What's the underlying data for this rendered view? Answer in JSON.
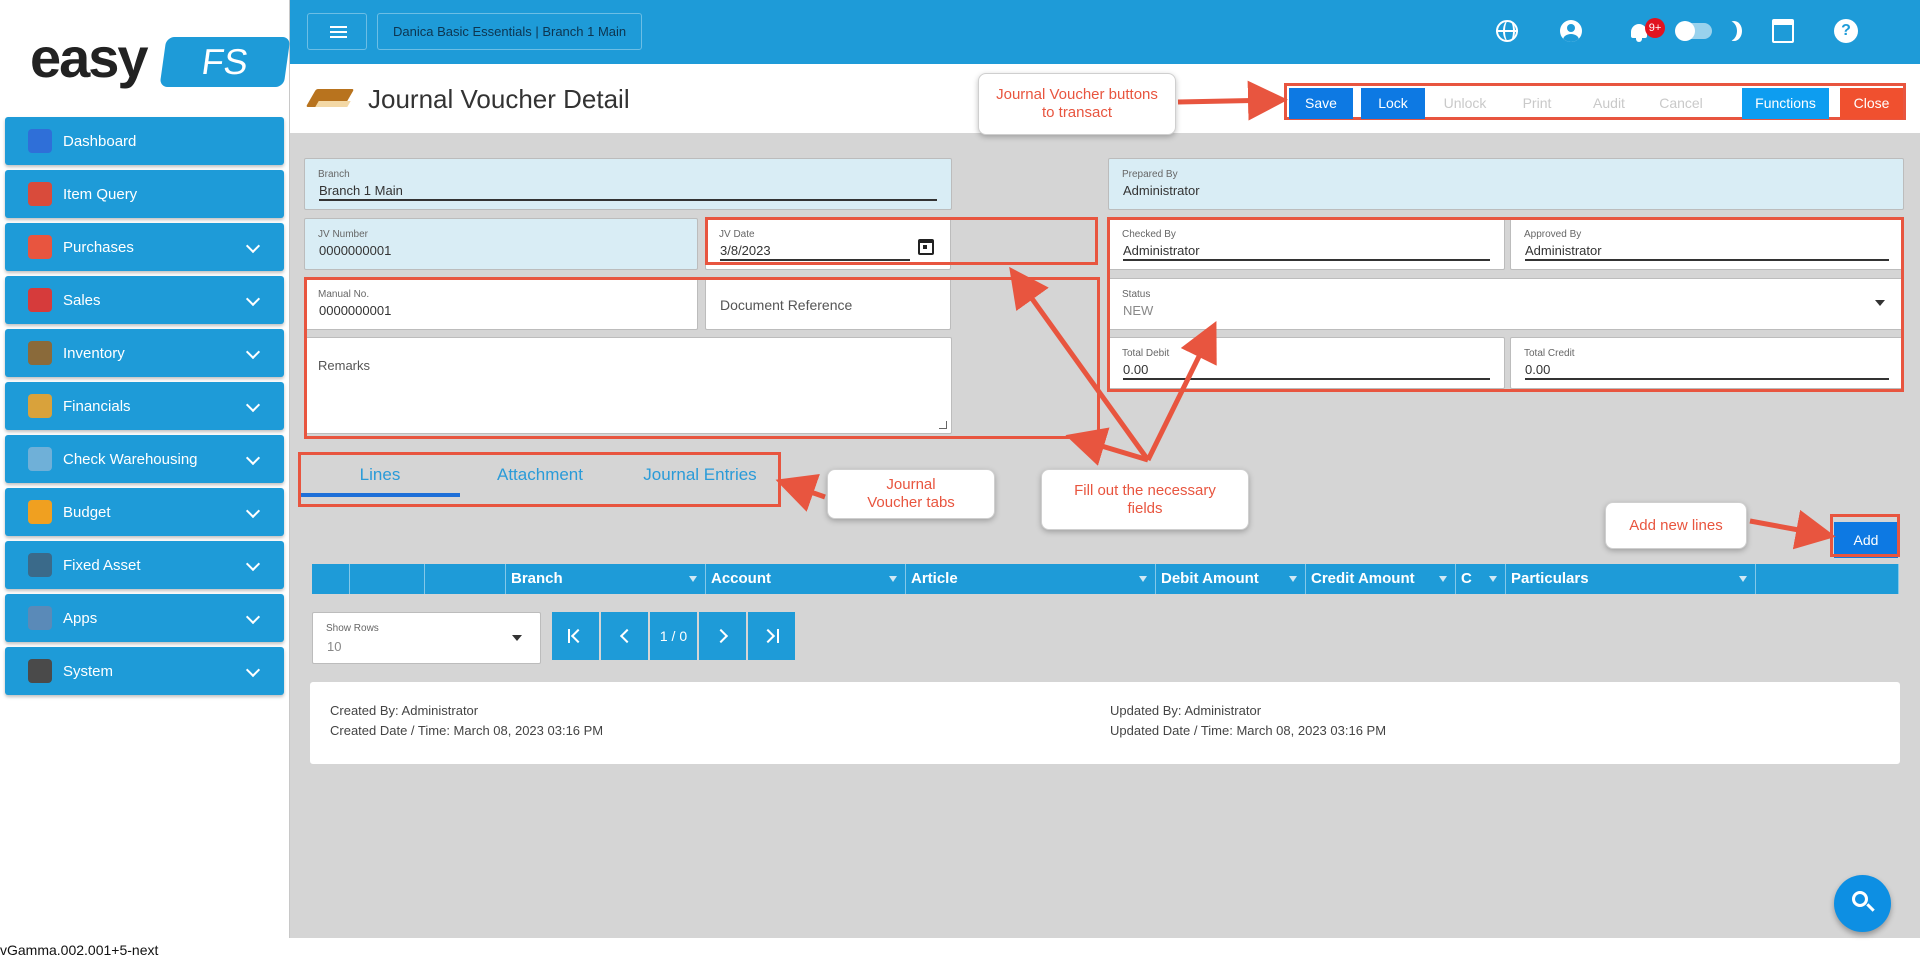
{
  "logo": {
    "word": "easy",
    "badge": "FS"
  },
  "sidebar": {
    "items": [
      {
        "label": "Dashboard",
        "icon": "dashboard-icon",
        "color": "#2f6fd8",
        "chevron": false
      },
      {
        "label": "Item Query",
        "icon": "basket-icon",
        "color": "#d94b3b",
        "chevron": false
      },
      {
        "label": "Purchases",
        "icon": "receipt-icon",
        "color": "#e8553f",
        "chevron": true
      },
      {
        "label": "Sales",
        "icon": "sale-tag-icon",
        "color": "#d63b3b",
        "chevron": true
      },
      {
        "label": "Inventory",
        "icon": "warehouse-icon",
        "color": "#8a6a3a",
        "chevron": true
      },
      {
        "label": "Financials",
        "icon": "ledger-icon",
        "color": "#d9a23b",
        "chevron": true
      },
      {
        "label": "Check Warehousing",
        "icon": "check-icon",
        "color": "#6fb0d8",
        "chevron": true
      },
      {
        "label": "Budget",
        "icon": "pie-chart-icon",
        "color": "#f0a020",
        "chevron": true
      },
      {
        "label": "Fixed Asset",
        "icon": "machine-icon",
        "color": "#3a6a8a",
        "chevron": true
      },
      {
        "label": "Apps",
        "icon": "apps-icon",
        "color": "#5a8ab8",
        "chevron": true
      },
      {
        "label": "System",
        "icon": "cog-icon",
        "color": "#4a4a4a",
        "chevron": true
      }
    ]
  },
  "topbar": {
    "company": "Danica Basic Essentials | Branch 1 Main",
    "notification_count": "9+"
  },
  "page": {
    "title": "Journal Voucher Detail"
  },
  "toolbar": {
    "save": "Save",
    "lock": "Lock",
    "unlock": "Unlock",
    "print": "Print",
    "audit": "Audit",
    "cancel": "Cancel",
    "functions": "Functions",
    "close": "Close"
  },
  "form": {
    "branch": {
      "label": "Branch",
      "value": "Branch 1 Main"
    },
    "prepared_by": {
      "label": "Prepared By",
      "value": "Administrator"
    },
    "jv_number": {
      "label": "JV Number",
      "value": "0000000001"
    },
    "jv_date": {
      "label": "JV Date",
      "value": "3/8/2023"
    },
    "checked_by": {
      "label": "Checked By",
      "value": "Administrator"
    },
    "approved_by": {
      "label": "Approved By",
      "value": "Administrator"
    },
    "manual_no": {
      "label": "Manual No.",
      "value": "0000000001"
    },
    "document_reference": {
      "label": "Document Reference"
    },
    "status": {
      "label": "Status",
      "value": "NEW"
    },
    "remarks": {
      "label": "Remarks"
    },
    "total_debit": {
      "label": "Total Debit",
      "value": "0.00"
    },
    "total_credit": {
      "label": "Total Credit",
      "value": "0.00"
    }
  },
  "tabs": [
    "Lines",
    "Attachment",
    "Journal Entries"
  ],
  "add_button": "Add",
  "grid": {
    "columns": [
      "",
      "",
      "",
      "Branch",
      "Account",
      "Article",
      "Debit Amount",
      "Credit Amount",
      "C",
      "Particulars",
      ""
    ]
  },
  "show_rows": {
    "label": "Show Rows",
    "value": "10"
  },
  "pager": {
    "page_info": "1 / 0"
  },
  "audit": {
    "created_by": "Created By: Administrator",
    "created_date": "Created Date / Time: March 08, 2023 03:16 PM",
    "updated_by": "Updated By: Administrator",
    "updated_date": "Updated Date / Time: March 08, 2023 03:16 PM"
  },
  "callouts": {
    "buttons": "Journal Voucher buttons to transact",
    "tabs": "Journal Voucher tabs",
    "fields": "Fill out the necessary fields",
    "add": "Add new lines"
  },
  "version": "vGamma.002.001+5-next",
  "colors": {
    "primary": "#1e9bd8",
    "button_blue": "#0d79e3",
    "close_red": "#f0502f",
    "annotation": "#e8553f"
  }
}
